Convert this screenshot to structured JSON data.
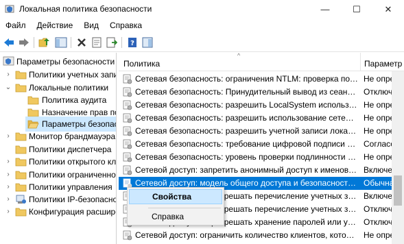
{
  "window": {
    "title": "Локальная политика безопасности",
    "min_glyph": "—",
    "max_glyph": "☐",
    "close_glyph": "✕"
  },
  "menu": [
    "Файл",
    "Действие",
    "Вид",
    "Справка"
  ],
  "toolbar_icons": [
    "back-arrow-icon",
    "forward-arrow-icon",
    "up-folder-icon",
    "show-hide-tree-icon",
    "delete-icon",
    "properties-icon",
    "export-list-icon",
    "help-icon",
    "console-pane-icon"
  ],
  "tree": {
    "items": [
      {
        "label": "Параметры безопасности",
        "expander": "",
        "level": 0
      },
      {
        "label": "Политики учетных записей",
        "expander": "›",
        "level": 1
      },
      {
        "label": "Локальные политики",
        "expander": "⌄",
        "level": 1
      },
      {
        "label": "Политика аудита",
        "expander": "",
        "level": 2
      },
      {
        "label": "Назначение прав пользователя",
        "expander": "",
        "level": 2
      },
      {
        "label": "Параметры безопасности",
        "expander": "",
        "level": 2,
        "selected": true
      },
      {
        "label": "Монитор брандмауэра",
        "expander": "›",
        "level": 1
      },
      {
        "label": "Политики диспетчера",
        "expander": "",
        "level": 1
      },
      {
        "label": "Политики открытого ключа",
        "expander": "›",
        "level": 1
      },
      {
        "label": "Политики ограниченного",
        "expander": "›",
        "level": 1
      },
      {
        "label": "Политики управления",
        "expander": "›",
        "level": 1
      },
      {
        "label": "Политики IP-безопасности",
        "expander": "›",
        "level": 1
      },
      {
        "label": "Конфигурация расширенной",
        "expander": "›",
        "level": 1
      }
    ]
  },
  "list": {
    "columns": {
      "policy": "Политика",
      "param": "Параметр"
    },
    "sort_glyph": "^",
    "rows": [
      {
        "policy": "Сетевая безопасность: ограничения NTLM: проверка подлинности",
        "param": "Не определено"
      },
      {
        "policy": "Сетевая безопасность: Принудительный вывод из сеанса по",
        "param": "Отключено"
      },
      {
        "policy": "Сетевая безопасность: разрешить LocalSystem использовать",
        "param": "Не определено"
      },
      {
        "policy": "Сетевая безопасность: разрешить использование сетевых",
        "param": "Не определено"
      },
      {
        "policy": "Сетевая безопасность: разрешить учетной записи локальной",
        "param": "Не определено"
      },
      {
        "policy": "Сетевая безопасность: требование цифровой подписи для",
        "param": "Согласовать"
      },
      {
        "policy": "Сетевая безопасность: уровень проверки подлинности LAN",
        "param": "Не определено"
      },
      {
        "policy": "Сетевой доступ: запретить анонимный доступ к именованным",
        "param": "Включено"
      },
      {
        "policy": "Сетевой доступ: модель общего доступа и безопасности для",
        "param": "Обычная",
        "selected": true
      },
      {
        "policy": "Сетевой доступ: не разрешать перечисление учетных записей",
        "param": "Включено"
      },
      {
        "policy": "Сетевой доступ: не разрешать перечисление учетных записей",
        "param": "Отключено"
      },
      {
        "policy": "Сетевой доступ: не разрешать хранение паролей или учетных",
        "param": "Отключено"
      },
      {
        "policy": "Сетевой доступ: ограничить количество клиентов, которые",
        "param": "Не определено"
      }
    ]
  },
  "context_menu": {
    "properties": "Свойства",
    "help": "Справка"
  }
}
